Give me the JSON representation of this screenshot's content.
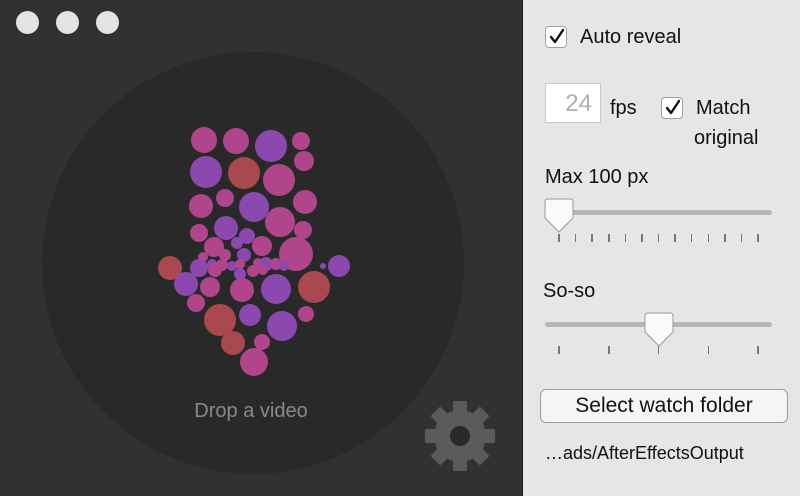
{
  "left_panel": {
    "drop_label": "Drop a video"
  },
  "right_panel": {
    "auto_reveal": {
      "label": "Auto reveal",
      "checked": true
    },
    "fps": {
      "value": "24",
      "unit_label": "fps"
    },
    "match_original": {
      "label_line1": "Match",
      "label_line2": "original",
      "checked": true
    },
    "max_size": {
      "label": "Max 100 px",
      "fraction": 0.0,
      "tick_count": 13
    },
    "quality": {
      "label": "So-so",
      "fraction": 0.5,
      "tick_count": 5
    },
    "select_folder_button": "Select watch folder",
    "folder_path": "…ads/AfterEffectsOutput"
  },
  "colors": {
    "left_background": "#323132",
    "drop_circle": "#2a292a",
    "right_background": "#e6e6e6",
    "bubble_purple": "#8b49b0",
    "bubble_magenta": "#b0458c",
    "bubble_red": "#a9484e"
  },
  "icons": [
    "traffic-light-close",
    "traffic-light-minimize",
    "traffic-light-zoom",
    "bubble-arrow-icon",
    "gear-icon",
    "checkmark-icon"
  ]
}
